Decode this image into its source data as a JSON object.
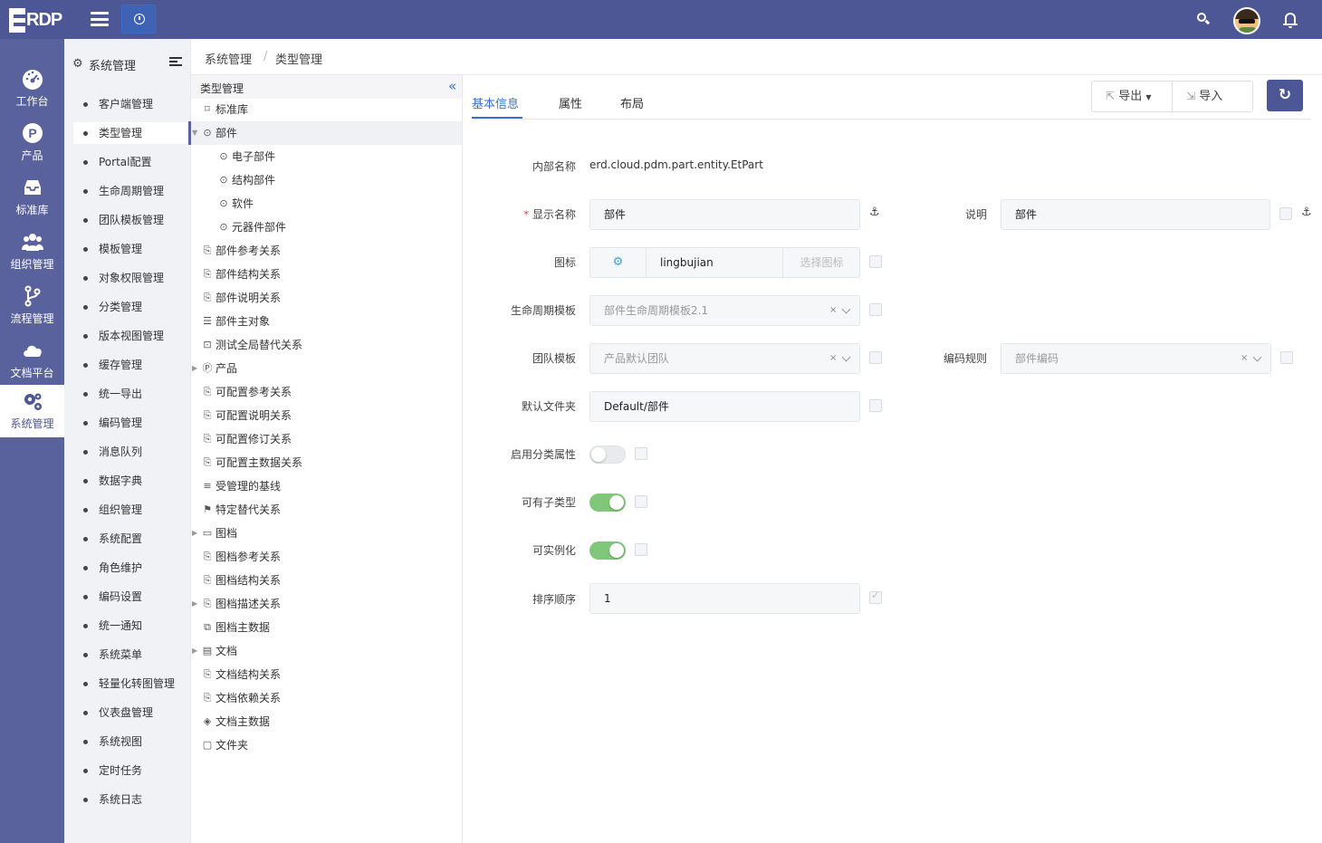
{
  "header": {
    "logo_text": "RDP",
    "search_icon": "search-icon",
    "notification_icon": "bell-icon"
  },
  "rail": [
    {
      "label": "工作台",
      "icon": "dashboard-icon"
    },
    {
      "label": "产品",
      "icon": "product-p-icon"
    },
    {
      "label": "标准库",
      "icon": "inbox-icon"
    },
    {
      "label": "组织管理",
      "icon": "users-icon"
    },
    {
      "label": "流程管理",
      "icon": "branch-icon"
    },
    {
      "label": "文档平台",
      "icon": "cloud-icon"
    },
    {
      "label": "系统管理",
      "icon": "gears-icon",
      "active": true
    }
  ],
  "menu": {
    "title": "系统管理",
    "items": [
      "客户端管理",
      "类型管理",
      "Portal配置",
      "生命周期管理",
      "团队模板管理",
      "模板管理",
      "对象权限管理",
      "分类管理",
      "版本视图管理",
      "缓存管理",
      "统一导出",
      "编码管理",
      "消息队列",
      "数据字典",
      "组织管理",
      "系统配置",
      "角色维护",
      "编码设置",
      "统一通知",
      "系统菜单",
      "轻量化转图管理",
      "仪表盘管理",
      "系统视图",
      "定时任务",
      "系统日志"
    ],
    "active_index": 1
  },
  "breadcrumb": {
    "root": "系统管理",
    "sep": "/",
    "current": "类型管理"
  },
  "tree": {
    "title": "类型管理",
    "collapse_glyph": "«",
    "nodes": [
      {
        "label": "标准库",
        "icon": "⌑",
        "level": 0
      },
      {
        "label": "部件",
        "icon": "⊙",
        "level": 0,
        "expanded": true,
        "selected": true
      },
      {
        "label": "电子部件",
        "icon": "⊙",
        "level": 1
      },
      {
        "label": "结构部件",
        "icon": "⊙",
        "level": 1
      },
      {
        "label": "软件",
        "icon": "⊙",
        "level": 1
      },
      {
        "label": "元器件部件",
        "icon": "⊙",
        "level": 1
      },
      {
        "label": "部件参考关系",
        "icon": "⎘",
        "level": 0
      },
      {
        "label": "部件结构关系",
        "icon": "⎘",
        "level": 0
      },
      {
        "label": "部件说明关系",
        "icon": "⎘",
        "level": 0
      },
      {
        "label": "部件主对象",
        "icon": "☰",
        "level": 0
      },
      {
        "label": "测试全局替代关系",
        "icon": "⊡",
        "level": 0
      },
      {
        "label": "产品",
        "icon": "Ⓟ",
        "level": 0,
        "collapsed": true
      },
      {
        "label": "可配置参考关系",
        "icon": "⎘",
        "level": 0
      },
      {
        "label": "可配置说明关系",
        "icon": "⎘",
        "level": 0
      },
      {
        "label": "可配置修订关系",
        "icon": "⎘",
        "level": 0
      },
      {
        "label": "可配置主数据关系",
        "icon": "⎘",
        "level": 0
      },
      {
        "label": "受管理的基线",
        "icon": "≡",
        "level": 0
      },
      {
        "label": "特定替代关系",
        "icon": "⚑",
        "level": 0
      },
      {
        "label": "图档",
        "icon": "▭",
        "level": 0,
        "collapsed": true
      },
      {
        "label": "图档参考关系",
        "icon": "⎘",
        "level": 0
      },
      {
        "label": "图档结构关系",
        "icon": "⎘",
        "level": 0
      },
      {
        "label": "图档描述关系",
        "icon": "⎘",
        "level": 0,
        "collapsed": true
      },
      {
        "label": "图档主数据",
        "icon": "⧉",
        "level": 0
      },
      {
        "label": "文档",
        "icon": "▤",
        "level": 0,
        "collapsed": true
      },
      {
        "label": "文档结构关系",
        "icon": "⎘",
        "level": 0
      },
      {
        "label": "文档依赖关系",
        "icon": "⎘",
        "level": 0
      },
      {
        "label": "文档主数据",
        "icon": "◈",
        "level": 0
      },
      {
        "label": "文件夹",
        "icon": "▢",
        "level": 0
      }
    ]
  },
  "tabs": [
    "基本信息",
    "属性",
    "布局"
  ],
  "toolbar": {
    "export_label": "导出",
    "import_label": "导入",
    "refresh_glyph": "↻"
  },
  "form": {
    "internal_name_label": "内部名称",
    "internal_name_value": "erd.cloud.pdm.part.entity.EtPart",
    "required_mark": "*",
    "display_name_label": "显示名称",
    "display_name_value": "部件",
    "description_label": "说明",
    "description_value": "部件",
    "icon_label": "图标",
    "icon_value": "lingbujian",
    "icon_button": "选择图标",
    "lifecycle_label": "生命周期模板",
    "lifecycle_value": "部件生命周期模板2.1",
    "team_label": "团队模板",
    "team_value": "产品默认团队",
    "code_rule_label": "编码规则",
    "code_rule_value": "部件编码",
    "folder_label": "默认文件夹",
    "folder_value": "Default/部件",
    "classify_label": "启用分类属性",
    "classify_on": false,
    "subtype_label": "可有子类型",
    "subtype_on": true,
    "instantiable_label": "可实例化",
    "instantiable_on": true,
    "sort_label": "排序顺序",
    "sort_value": "1",
    "clear_glyph": "×"
  },
  "colors": {
    "primary": "#4e5795",
    "rail": "#5a629d",
    "link": "#3c6fd1",
    "toggle_on": "#80c77b"
  }
}
